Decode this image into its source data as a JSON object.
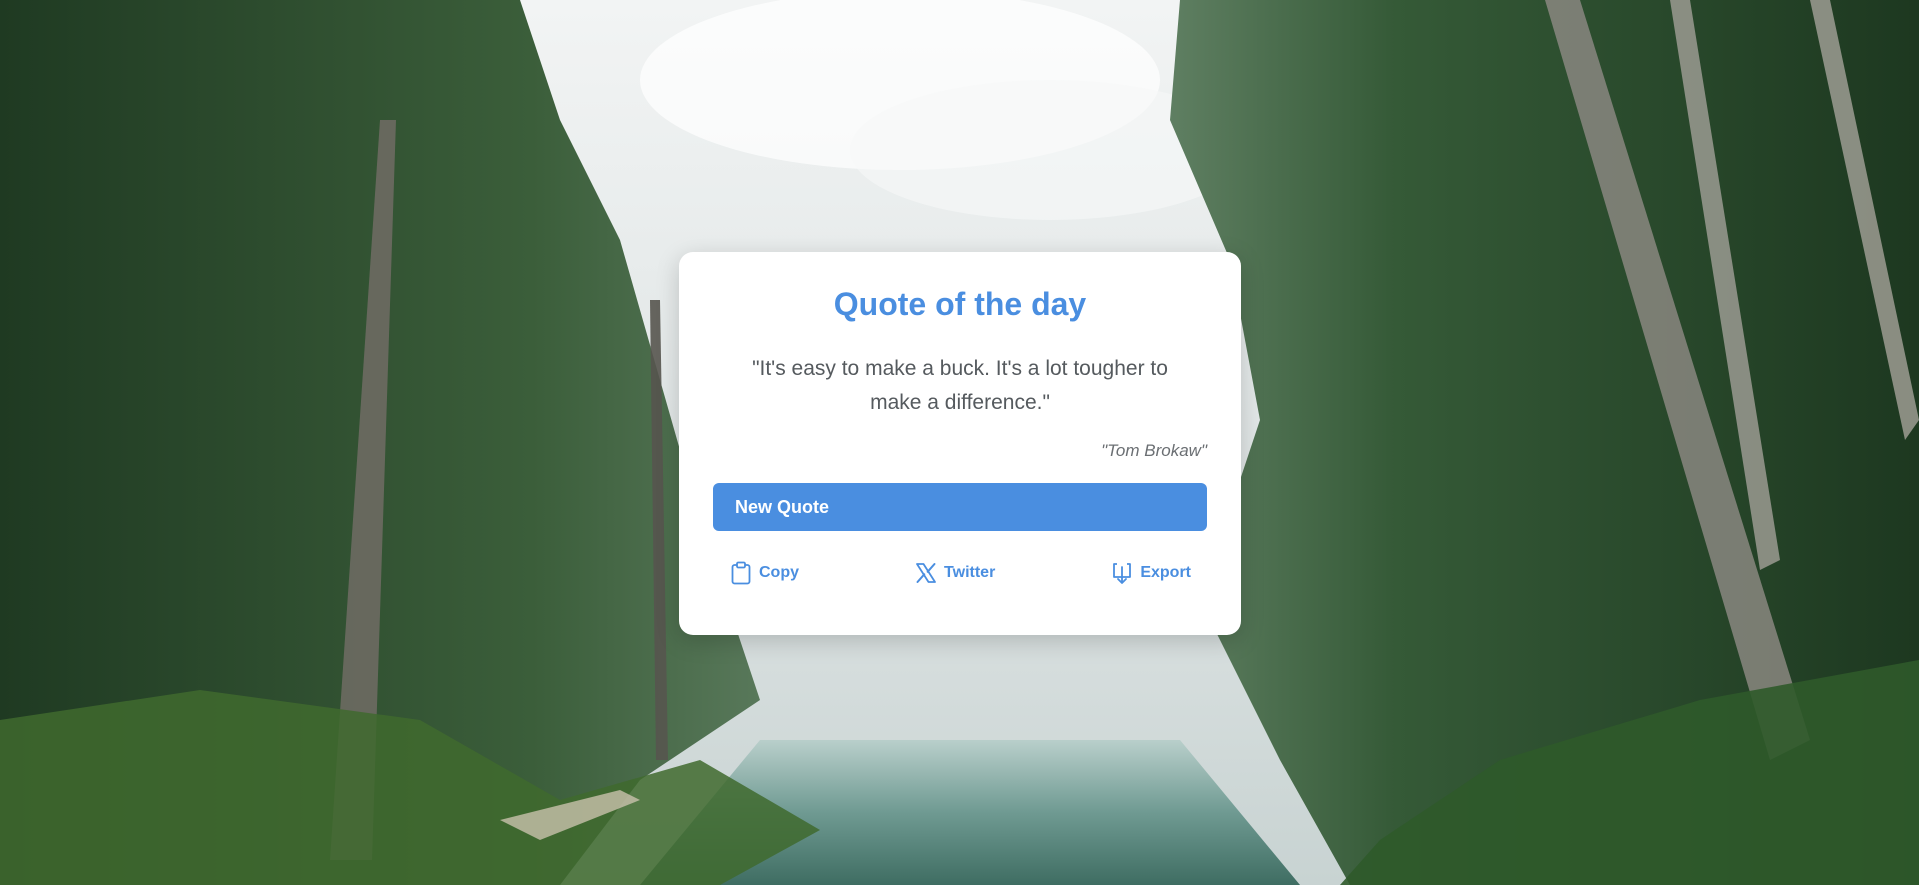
{
  "card": {
    "title": "Quote of the day",
    "quote": "\"It's easy to make a buck. It's a lot tougher to make a difference.\"",
    "author": "\"Tom Brokaw\"",
    "new_quote_label": "New Quote"
  },
  "actions": [
    {
      "label": "Copy",
      "icon": "clipboard-icon"
    },
    {
      "label": "Twitter",
      "icon": "x-twitter-icon"
    },
    {
      "label": "Export",
      "icon": "export-download-icon"
    }
  ],
  "colors": {
    "accent": "#4a8ee0",
    "card_background": "#ffffff",
    "quote_text": "#555a5e",
    "author_text": "#6b6f73"
  },
  "background": {
    "icon": "forest-lake-photo"
  }
}
